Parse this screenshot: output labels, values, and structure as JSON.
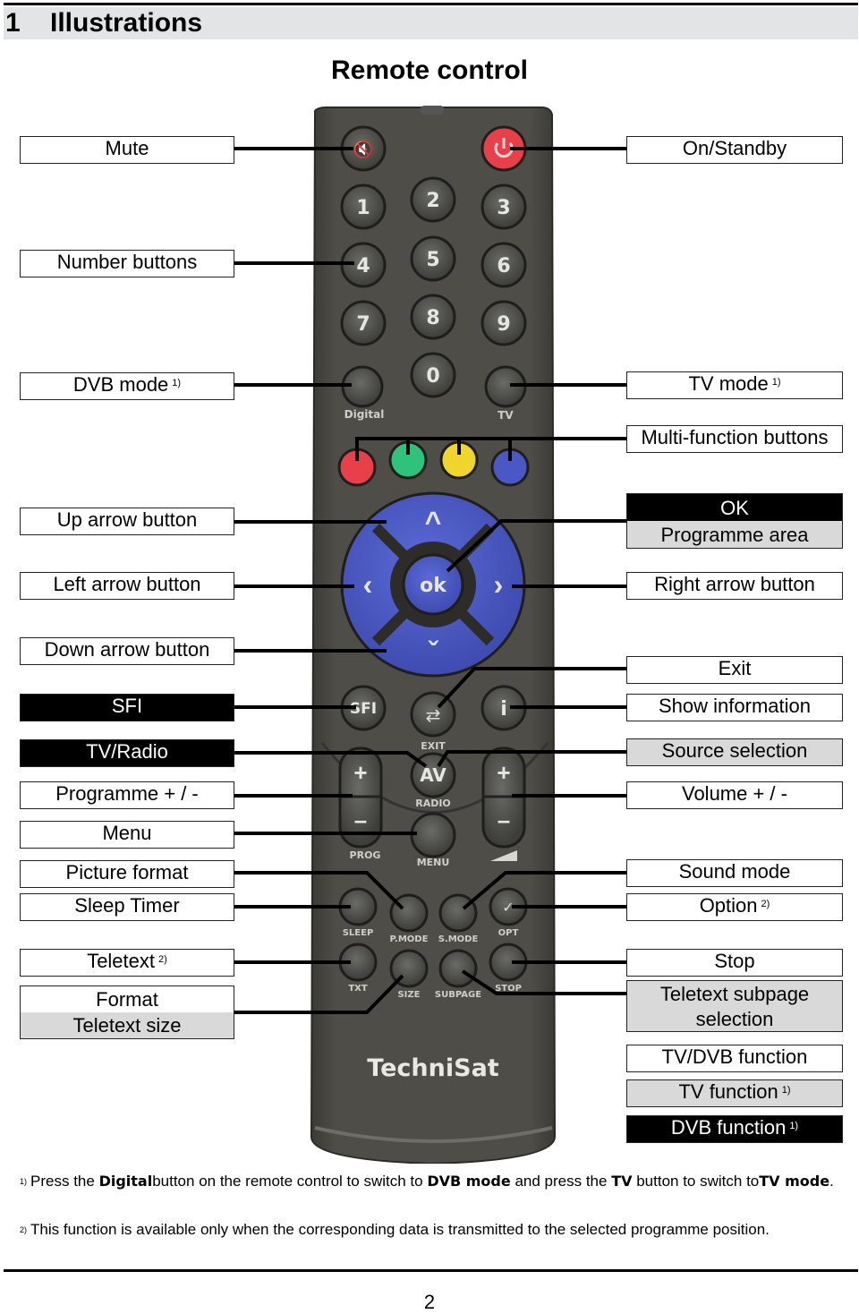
{
  "section": {
    "number": "1",
    "title": "Illustrations"
  },
  "page_title": "Remote control",
  "brand": "TechniSat",
  "labels_left": [
    {
      "id": "mute",
      "text": "Mute",
      "sup": ""
    },
    {
      "id": "number-buttons",
      "text": "Number buttons",
      "sup": ""
    },
    {
      "id": "dvb-mode",
      "text": "DVB mode",
      "sup": "1)"
    },
    {
      "id": "up-arrow",
      "text": "Up arrow button",
      "sup": ""
    },
    {
      "id": "left-arrow",
      "text": "Left arrow button",
      "sup": ""
    },
    {
      "id": "down-arrow",
      "text": "Down arrow button",
      "sup": ""
    },
    {
      "id": "sfi",
      "text": "SFI",
      "sup": ""
    },
    {
      "id": "tv-radio",
      "text": "TV/Radio",
      "sup": ""
    },
    {
      "id": "programme",
      "text": "Programme + / -",
      "sup": ""
    },
    {
      "id": "menu",
      "text": "Menu",
      "sup": ""
    },
    {
      "id": "picture-format",
      "text": "Picture format",
      "sup": ""
    },
    {
      "id": "sleep-timer",
      "text": "Sleep Timer",
      "sup": ""
    },
    {
      "id": "teletext",
      "text": "Teletext",
      "sup": "2)"
    }
  ],
  "format_box": {
    "line1": "Format",
    "line2": "Teletext size"
  },
  "labels_right": [
    {
      "id": "on-standby",
      "text": "On/Standby",
      "sup": ""
    },
    {
      "id": "tv-mode",
      "text": "TV mode",
      "sup": "1)"
    },
    {
      "id": "multi-function",
      "text": "Multi-function buttons",
      "sup": ""
    },
    {
      "id": "right-arrow",
      "text": "Right arrow button",
      "sup": ""
    },
    {
      "id": "exit",
      "text": "Exit",
      "sup": ""
    },
    {
      "id": "show-info",
      "text": "Show information",
      "sup": ""
    },
    {
      "id": "source-selection",
      "text": "Source selection",
      "sup": ""
    },
    {
      "id": "volume",
      "text": "Volume + / -",
      "sup": ""
    },
    {
      "id": "sound-mode",
      "text": "Sound mode",
      "sup": ""
    },
    {
      "id": "option",
      "text": "Option",
      "sup": "2)"
    },
    {
      "id": "stop",
      "text": "Stop",
      "sup": ""
    }
  ],
  "ok_box": {
    "line1": "OK",
    "line2": "Programme area"
  },
  "subpage_box": {
    "line1": "Teletext subpage",
    "line2": "selection"
  },
  "legend": {
    "tv_dvb": "TV/DVB function",
    "tv": "TV function",
    "tv_sup": "1)",
    "dvb": "DVB function",
    "dvb_sup": "1)"
  },
  "remote_buttons": {
    "digits": [
      "1",
      "2",
      "3",
      "4",
      "5",
      "6",
      "7",
      "8",
      "9",
      "0"
    ],
    "digital": "Digital",
    "tv": "TV",
    "ok": "ok",
    "sfi": "SFI",
    "info": "i",
    "exit": "EXIT",
    "av": "AV",
    "radio": "RADIO",
    "prog": "PROG",
    "menu": "MENU",
    "sleep": "SLEEP",
    "pmode": "P.MODE",
    "smode": "S.MODE",
    "opt": "OPT",
    "txt": "TXT",
    "size": "SIZE",
    "subpage": "SUBPAGE",
    "stop": "STOP",
    "plus": "+",
    "minus": "–"
  },
  "colors": {
    "red": "#e8404a",
    "green": "#2fc27a",
    "yellow": "#f0d52c",
    "blue": "#4a58c4",
    "body": "#4b4a44"
  },
  "footnotes": [
    {
      "mark": "1)",
      "parts": [
        {
          "t": "Press the ",
          "b": false
        },
        {
          "t": "Digital",
          "b": true
        },
        {
          "t": "button on the remote control to switch to ",
          "b": false
        },
        {
          "t": "DVB mode",
          "b": true
        },
        {
          "t": " and press the ",
          "b": false
        },
        {
          "t": "TV",
          "b": true
        },
        {
          "t": " button to switch to",
          "b": false
        },
        {
          "t": "TV mode",
          "b": true
        },
        {
          "t": ".",
          "b": false
        }
      ]
    },
    {
      "mark": "2)",
      "parts": [
        {
          "t": "This function is available only when the corresponding data is transmitted to the selected programme position.",
          "b": false
        }
      ]
    }
  ],
  "page_number": "2"
}
